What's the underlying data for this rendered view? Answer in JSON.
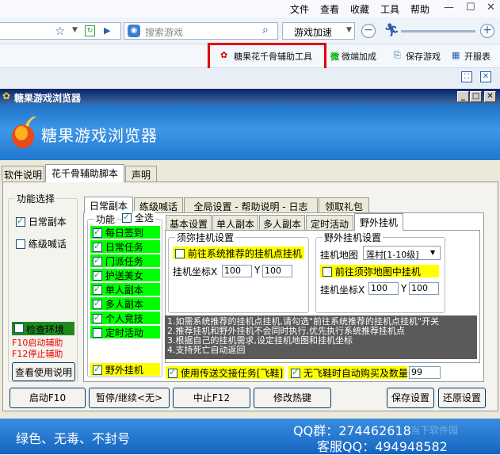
{
  "menu": [
    "文件",
    "查看",
    "收藏",
    "工具",
    "帮助"
  ],
  "search": {
    "placeholder": "搜索游戏"
  },
  "game_accel": "游戏加速",
  "toolbar2": {
    "candy_tool": "糖果花千骨辅助工具",
    "weiduan": "微端加成",
    "save_game": "保存游戏",
    "open_table": "开服表"
  },
  "app": {
    "window_title": "糖果游戏浏览器",
    "banner_title": "糖果游戏浏览器",
    "main_tabs": [
      "软件说明",
      "花千骨辅助脚本",
      "声明"
    ],
    "left": {
      "group_title": "功能选择",
      "daily_dungeon": "日常副本",
      "level_shout": "练级喊话",
      "check_env": "检查环境",
      "f10_hint": "F10启动辅助",
      "f12_hint": "F12停止辅助",
      "view_help": "查看使用说明"
    },
    "sub_tabs": [
      "日常副本",
      "练级喊话",
      "全局设置 - 帮助说明 - 日志",
      "领取礼包"
    ],
    "func": {
      "title": "功能",
      "select_all": "全选",
      "items": [
        "每日签到",
        "日常任务",
        "门派任务",
        "护送美女",
        "单人副本",
        "多人副本",
        "个人竞技",
        "定时活动"
      ],
      "wild": "野外挂机"
    },
    "inner_tabs": [
      "基本设置",
      "单人副本",
      "多人副本",
      "定时活动",
      "野外挂机"
    ],
    "xumi": {
      "title": "须弥挂机设置",
      "goto": "前往系统推荐的挂机点挂机",
      "coord_label": "挂机坐标X",
      "x": "100",
      "y_label": "Y",
      "y": "100"
    },
    "wild": {
      "title": "野外挂机设置",
      "map_label": "挂机地图",
      "map_value": "莲村[1-10级]",
      "goto": "前往须弥地图中挂机",
      "coord_label": "挂机坐标X",
      "x": "100",
      "y_label": "Y",
      "y": "100"
    },
    "info_lines": [
      "1.如需系统推荐的挂机点挂机,请勾选\"前往系统推荐的挂机点挂机\"开关",
      "2.推荐挂机和野外挂机不会同时执行,优先执行系统推荐挂机点",
      "3.根据自己的挂机需求,设定挂机地图和挂机坐标",
      "4.支持死亡自动返回"
    ],
    "transfer": "使用传送交接任务[飞鞋]",
    "auto_buy": "无飞鞋时自动购买及数量",
    "auto_buy_qty": "99",
    "buttons": {
      "start": "启动F10",
      "pause": "暂停/继续<无>",
      "stop": "中止F12",
      "hotkey": "修改热键",
      "save": "保存设置",
      "restore": "还原设置"
    },
    "footer": {
      "slogan": "绿色、无毒、不封号",
      "qq_group": "QQ群：274462618",
      "service_qq": "客服QQ：494948582",
      "watermark": "当下软件园"
    }
  },
  "colors": {
    "highlight_red": "#e30000",
    "green_rows": "#00ff00",
    "yellow_rows": "#ffff00",
    "banner_blue": "#2078d0"
  }
}
